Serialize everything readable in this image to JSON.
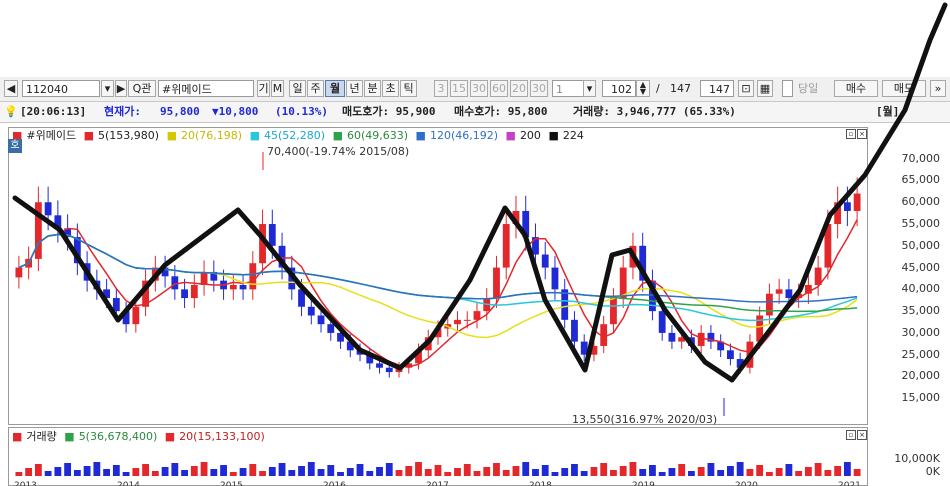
{
  "toolbar": {
    "code": "112040",
    "name": "#위메이드",
    "search_label": "Q관",
    "btn_gi": "기",
    "btn_m": "M",
    "periods": [
      "일",
      "주",
      "월",
      "년",
      "분",
      "초",
      "틱"
    ],
    "selected_period": "월",
    "minutes": [
      "3",
      "15",
      "30",
      "60",
      "20",
      "30"
    ],
    "count_value": "1",
    "page_current": "102",
    "page_sep": "/",
    "page_total": "147",
    "page_total_box": "147",
    "same_day_label": "당일",
    "buy_label": "매수",
    "sell_label": "매도"
  },
  "info": {
    "time": "[20:06:13]",
    "price_label": "현재가:",
    "price": "95,800",
    "change": "▼10,800",
    "change_pct": "(10.13%)",
    "ask": "매도호가: 95,900",
    "bid": "매수호가: 95,800",
    "volume": "거래량: 3,946,777  (65.33%)",
    "period_tag": "[월]"
  },
  "colors": {
    "up": "#e3282b",
    "down": "#1f2ad4",
    "ma5": "#e3282b",
    "ma20": "#e6e01a",
    "ma45": "#25c9d9",
    "ma60": "#2ea34a",
    "ma120": "#2e6fc7",
    "ma200": "#c640c9",
    "ma224": "#111111"
  },
  "legend": {
    "corner": "호",
    "name": "#위메이드",
    "ma5": "5(153,980)",
    "ma20": "20(76,198)",
    "ma45": "45(52,280)",
    "ma60": "60(49,633)",
    "ma120": "120(46,192)",
    "ma200": "200",
    "ma224": "224"
  },
  "annotations": {
    "high": "70,400(-19.74% 2015/08)",
    "low": "13,550(316.97% 2020/03)"
  },
  "volume_legend": {
    "title": "거래량",
    "ma5": "5(36,678,400)",
    "ma20": "20(15,133,100)"
  },
  "chart_data": {
    "type": "candlestick",
    "y_ticks": [
      "70,000",
      "65,000",
      "60,000",
      "55,000",
      "50,000",
      "45,000",
      "40,000",
      "35,000",
      "30,000",
      "25,000",
      "20,000",
      "15,000"
    ],
    "volume_ticks": [
      "10,000K",
      "0K"
    ],
    "x_ticks": [
      "2013",
      "2014",
      "2015",
      "2016",
      "2017",
      "2018",
      "2019",
      "2020",
      "2021"
    ],
    "ylim": [
      10000,
      72000
    ],
    "close_trace": [
      45000,
      47000,
      60000,
      57000,
      54000,
      52000,
      46000,
      42000,
      40000,
      38000,
      35000,
      32000,
      36000,
      42000,
      45000,
      43000,
      40000,
      38000,
      41000,
      44000,
      42000,
      40000,
      41000,
      40000,
      46000,
      55000,
      50000,
      45000,
      40000,
      36000,
      34000,
      32000,
      30000,
      28000,
      26000,
      25000,
      23000,
      22000,
      21000,
      22000,
      23000,
      26000,
      29000,
      31000,
      32000,
      33000,
      33000,
      35000,
      38000,
      45000,
      55000,
      58000,
      52000,
      48000,
      45000,
      40000,
      33000,
      28000,
      25000,
      27000,
      32000,
      38000,
      45000,
      50000,
      42000,
      35000,
      30000,
      28000,
      29000,
      27000,
      30000,
      28000,
      26000,
      24000,
      22000,
      28000,
      34000,
      39000,
      40000,
      38000,
      39000,
      41000,
      45000,
      55000,
      60000,
      58000,
      62000
    ]
  }
}
